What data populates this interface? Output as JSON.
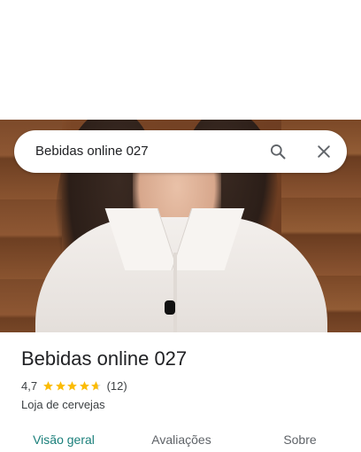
{
  "search": {
    "query": "Bebidas online 027",
    "search_icon": "search-icon",
    "close_icon": "close-icon"
  },
  "place": {
    "name": "Bebidas online 027",
    "rating": "4,7",
    "stars_value": 4.7,
    "stars_max": 5,
    "review_count": "(12)",
    "category": "Loja de cervejas"
  },
  "tabs": [
    {
      "label": "Visão geral",
      "active": true
    },
    {
      "label": "Avaliações",
      "active": false
    },
    {
      "label": "Sobre",
      "active": false
    }
  ],
  "colors": {
    "accent": "#1a7f7a",
    "star": "#fbbc04",
    "star_empty": "#dadce0",
    "text_primary": "#202124",
    "text_secondary": "#3c4043"
  }
}
